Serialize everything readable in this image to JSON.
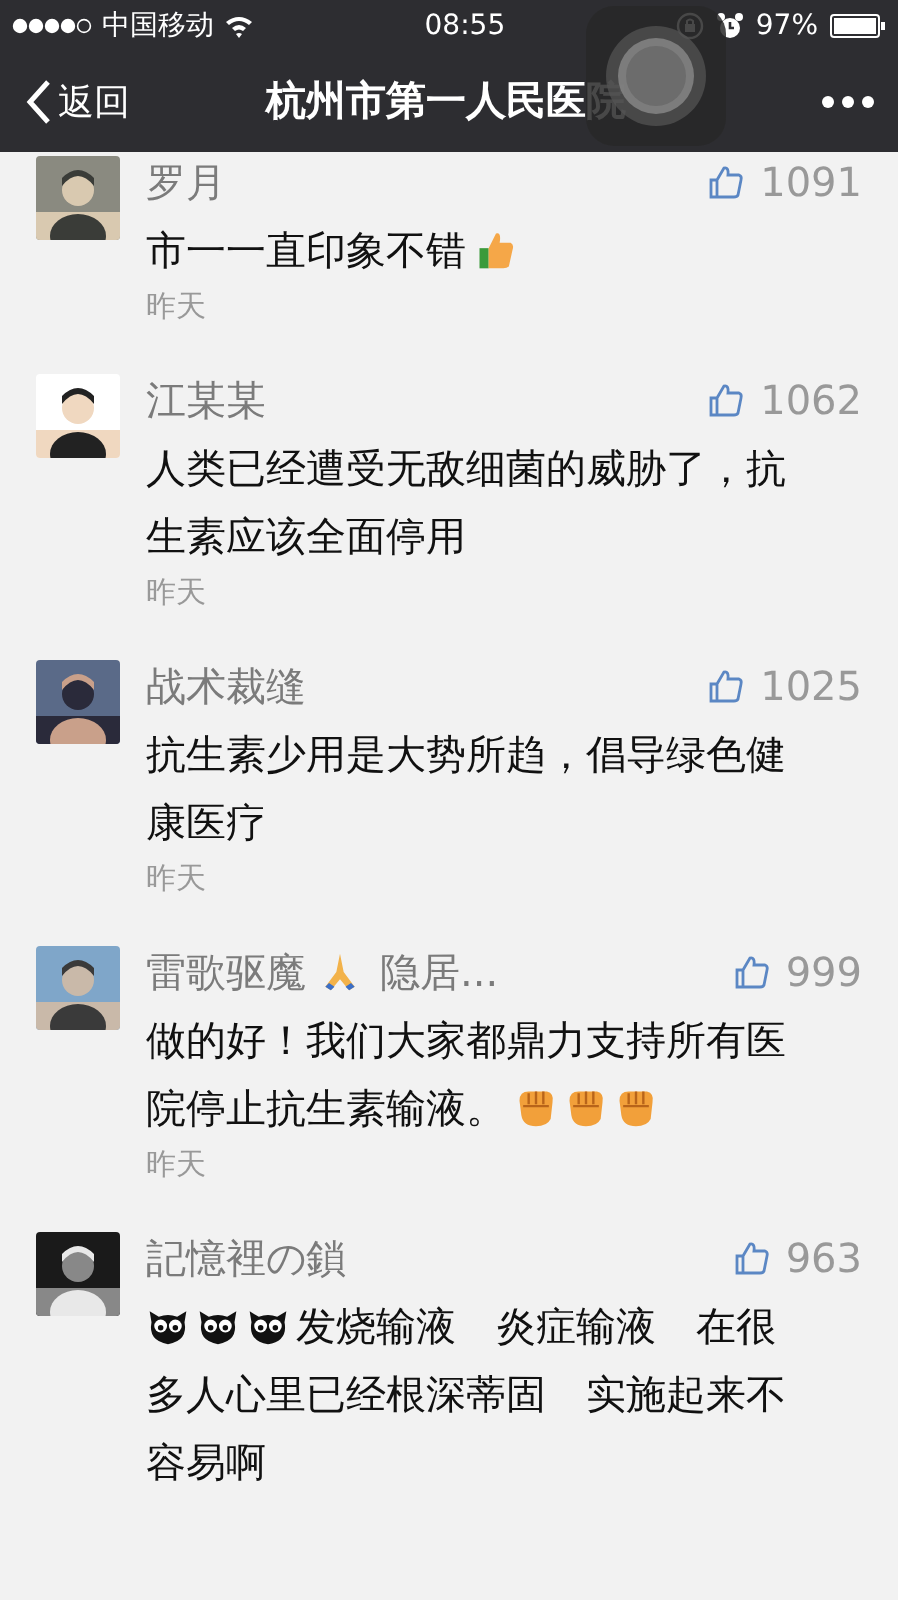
{
  "status_bar": {
    "carrier": "中国移动",
    "time": "08:55",
    "battery": "97%"
  },
  "nav": {
    "back": "返回",
    "title": "杭州市第一人民医院"
  },
  "comments": [
    {
      "name": [
        {
          "kind": "text",
          "text": "罗月"
        }
      ],
      "likes": "1091",
      "body": [
        {
          "kind": "text",
          "text": "市一一直印象不错"
        },
        {
          "kind": "thumbs-up"
        }
      ],
      "time": "昨天"
    },
    {
      "name": [
        {
          "kind": "text",
          "text": "江某某"
        }
      ],
      "likes": "1062",
      "body": [
        {
          "kind": "text",
          "text": "人类已经遭受无敌细菌的威胁了，抗"
        },
        {
          "kind": "text",
          "text": "生素应该全面停用"
        }
      ],
      "time": "昨天"
    },
    {
      "name": [
        {
          "kind": "text",
          "text": "战术裁缝"
        }
      ],
      "likes": "1025",
      "body": [
        {
          "kind": "text",
          "text": "抗生素少用是大势所趋，倡导绿色健"
        },
        {
          "kind": "text",
          "text": "康医疗"
        }
      ],
      "time": "昨天"
    },
    {
      "name": [
        {
          "kind": "text",
          "text": "雷歌驱魔"
        },
        {
          "kind": "pray"
        },
        {
          "kind": "text",
          "text": "隐居..."
        }
      ],
      "likes": "999",
      "body": [
        {
          "kind": "text",
          "text": "做的好！我们大家都鼎力支持所有医"
        },
        {
          "kind": "text",
          "text": "院停止抗生素输液。"
        },
        {
          "kind": "fist"
        },
        {
          "kind": "fist"
        },
        {
          "kind": "fist"
        }
      ],
      "time": "昨天"
    },
    {
      "name": [
        {
          "kind": "text",
          "text": "記憶裡の鎖"
        }
      ],
      "likes": "963",
      "body": [
        {
          "kind": "owl"
        },
        {
          "kind": "owl"
        },
        {
          "kind": "owl"
        },
        {
          "kind": "text",
          "text": "发烧输液　炎症输液　在很"
        },
        {
          "kind": "text",
          "text": "多人心里已经根深蒂固　实施起来不"
        },
        {
          "kind": "text",
          "text": "容易啊"
        }
      ]
    }
  ]
}
